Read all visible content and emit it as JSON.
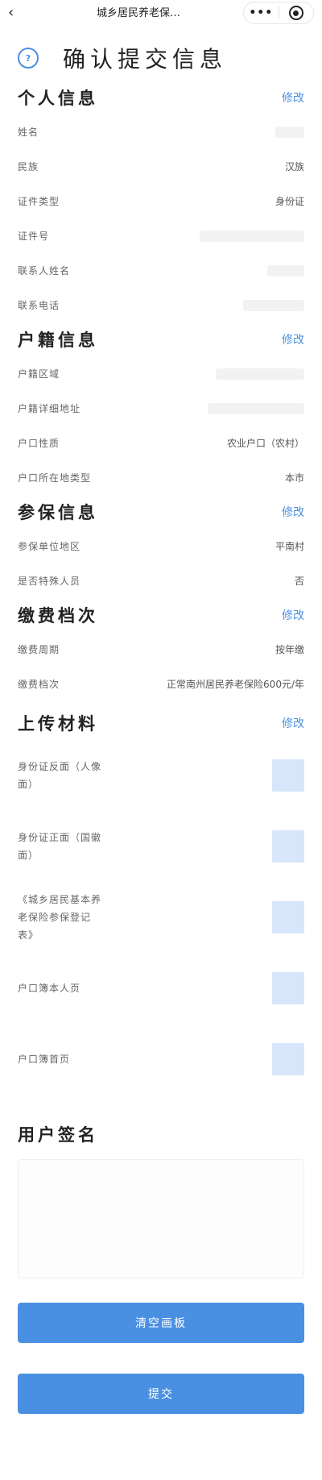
{
  "navbar": {
    "back_icon": "chevron-left-icon",
    "title": "城乡居民养老保…",
    "more": "•••"
  },
  "header": {
    "title": "确认提交信息"
  },
  "personal": {
    "title": "个人信息",
    "edit": "修改",
    "rows": [
      {
        "label": "姓名",
        "value": ""
      },
      {
        "label": "民族",
        "value": "汉族"
      },
      {
        "label": "证件类型",
        "value": "身份证"
      },
      {
        "label": "证件号",
        "value": ""
      },
      {
        "label": "联系人姓名",
        "value": ""
      },
      {
        "label": "联系电话",
        "value": ""
      }
    ]
  },
  "household": {
    "title": "户籍信息",
    "edit": "修改",
    "rows": [
      {
        "label": "户籍区域",
        "value": ""
      },
      {
        "label": "户籍详细地址",
        "value": ""
      },
      {
        "label": "户口性质",
        "value": "农业户口（农村）"
      },
      {
        "label": "户口所在地类型",
        "value": "本市"
      }
    ]
  },
  "insurance": {
    "title": "参保信息",
    "edit": "修改",
    "rows": [
      {
        "label": "参保单位地区",
        "value": "平南村"
      },
      {
        "label": "是否特殊人员",
        "value": "否"
      }
    ]
  },
  "payment": {
    "title": "缴费档次",
    "edit": "修改",
    "rows": [
      {
        "label": "缴费周期",
        "value": "按年缴"
      },
      {
        "label": "缴费档次",
        "value": "正常南州居民养老保险600元/年"
      }
    ]
  },
  "uploads": {
    "title": "上传材料",
    "edit": "修改",
    "items": [
      {
        "label": "身份证反面（人像面）"
      },
      {
        "label": "身份证正面（国徽面）"
      },
      {
        "label": "《城乡居民基本养老保险参保登记表》"
      },
      {
        "label": "户口簿本人页"
      },
      {
        "label": "户口簿首页"
      }
    ]
  },
  "signature": {
    "title": "用户签名"
  },
  "buttons": {
    "clear": "清空画板",
    "submit": "提交"
  },
  "colors": {
    "accent": "#4a90e2",
    "thumb": "#d7e6fb"
  }
}
